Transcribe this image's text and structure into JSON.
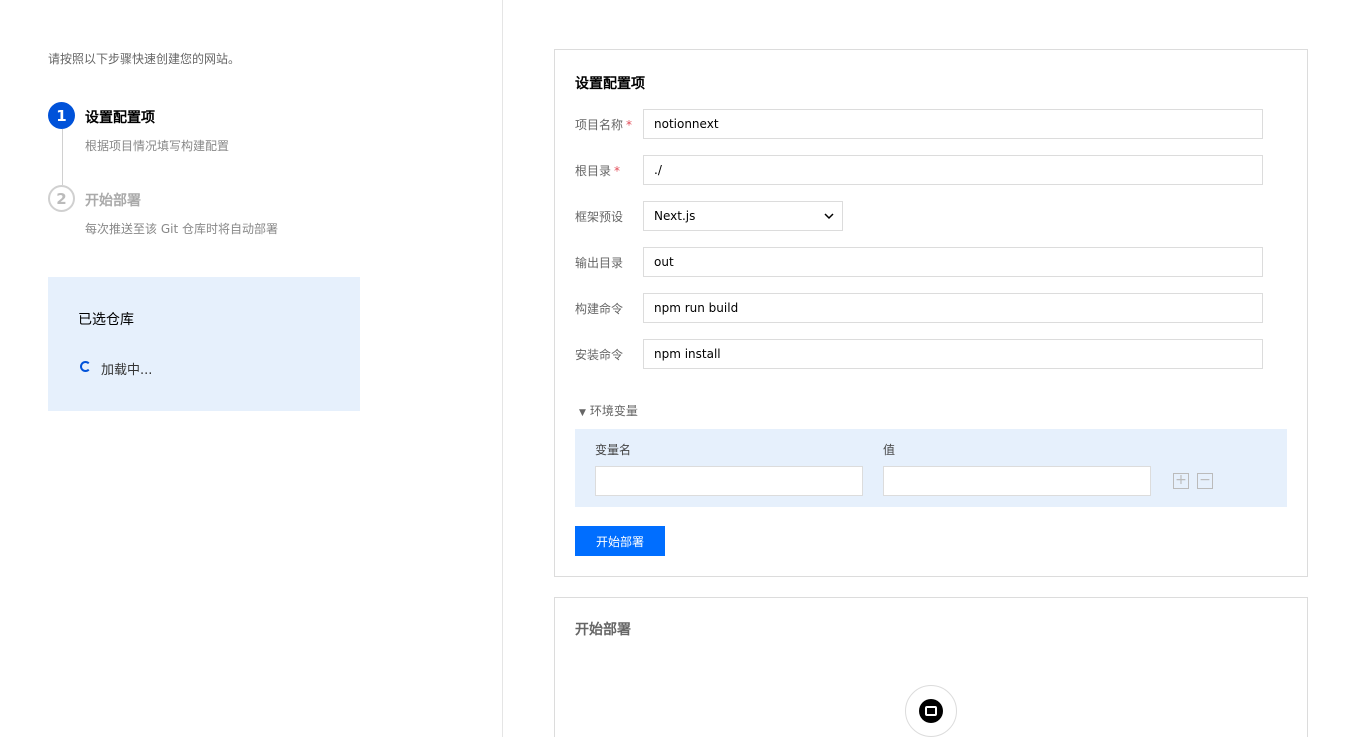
{
  "intro": "请按照以下步骤快速创建您的网站。",
  "steps": [
    {
      "num": "1",
      "title": "设置配置项",
      "desc": "根据项目情况填写构建配置"
    },
    {
      "num": "2",
      "title": "开始部署",
      "desc": "每次推送至该 Git 仓库时将自动部署"
    }
  ],
  "repo": {
    "title": "已选仓库",
    "loading": "加载中..."
  },
  "config": {
    "title": "设置配置项",
    "fields": [
      {
        "label": "项目名称",
        "required": "*",
        "value": "notionnext"
      },
      {
        "label": "根目录",
        "required": "*",
        "value": "./"
      },
      {
        "label": "框架预设",
        "value": "Next.js"
      },
      {
        "label": "输出目录",
        "value": "out"
      },
      {
        "label": "构建命令",
        "value": "npm run build"
      },
      {
        "label": "安装命令",
        "value": "npm install"
      }
    ],
    "env": {
      "toggle": "环境变量",
      "name_header": "变量名",
      "value_header": "值",
      "add": "+",
      "remove": "−"
    },
    "deploy_button": "开始部署"
  },
  "deploy_card": {
    "title": "开始部署"
  },
  "colors": {
    "primary": "#0052d9",
    "button": "#006eff",
    "panel": "#e6f0fc",
    "required": "#e34d59"
  }
}
